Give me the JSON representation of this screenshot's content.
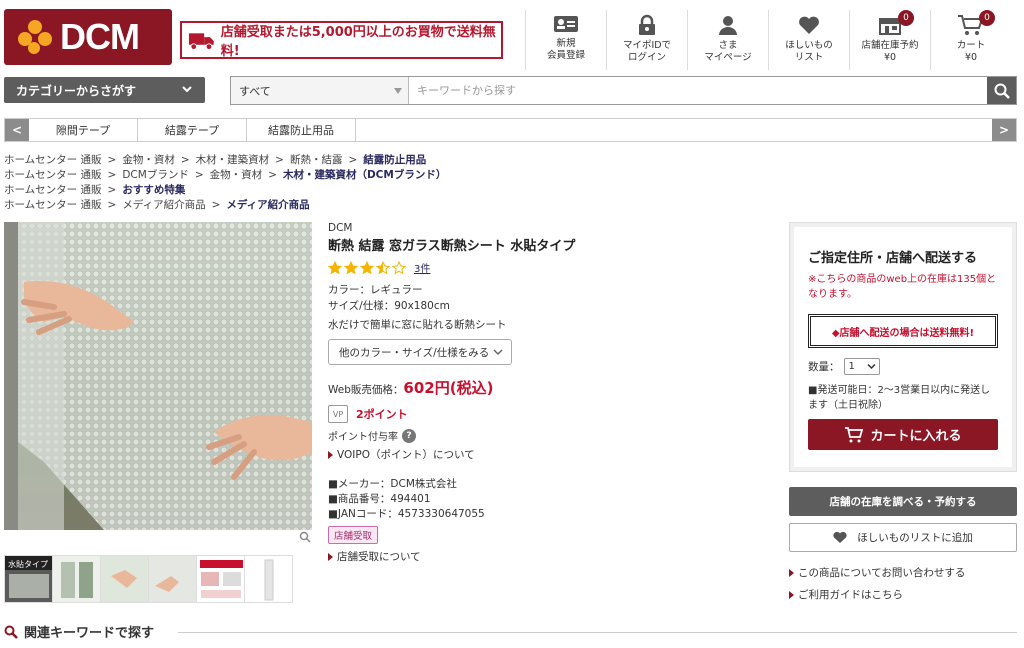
{
  "header": {
    "logo_text": "DCM",
    "promo_text": "店舗受取または5,000円以上のお買物で送料無料!",
    "nav": [
      {
        "line1": "新規",
        "line2": "会員登録",
        "icon": "member-card-icon"
      },
      {
        "line1": "マイポIDで",
        "line2": "ログイン",
        "icon": "lock-icon"
      },
      {
        "line1": "さま",
        "line2": "マイページ",
        "icon": "user-icon"
      },
      {
        "line1": "ほしいもの",
        "line2": "リスト",
        "icon": "heart-icon"
      },
      {
        "line1": "店舗在庫予約",
        "line2": "¥0",
        "icon": "store-icon",
        "badge": "0"
      },
      {
        "line1": "カート",
        "line2": "¥0",
        "icon": "cart-icon",
        "badge": "0"
      }
    ]
  },
  "search": {
    "category_button": "カテゴリーからさがす",
    "scope": "すべて",
    "placeholder": "キーワードから探す"
  },
  "tabs": {
    "prev": "<",
    "next": ">",
    "items": [
      "隙間テープ",
      "結露テープ",
      "結露防止用品"
    ]
  },
  "breadcrumbs": [
    [
      "ホームセンター 通販",
      "金物・資材",
      "木材・建築資材",
      "断熱・結露",
      "結露防止用品"
    ],
    [
      "ホームセンター 通販",
      "DCMブランド",
      "金物・資材",
      "木材・建築資材（DCMブランド）"
    ],
    [
      "ホームセンター 通販",
      "おすすめ特集"
    ],
    [
      "ホームセンター 通販",
      "メディア紹介商品",
      "メディア紹介商品"
    ]
  ],
  "product": {
    "brand": "DCM",
    "title": "断熱 結露 窓ガラス断熱シート 水貼タイプ",
    "rating": 3.5,
    "review_count": "3件",
    "color": "カラー：レギュラー",
    "size": "サイズ/仕様：90x180cm",
    "catch": "水だけで簡単に窓に貼れる断熱シート",
    "variant_button": "他のカラー・サイズ/仕様をみる",
    "price_label": "Web販売価格：",
    "price": "602円(税込)",
    "vp_label": "VP",
    "points": "2ポイント",
    "point_rate_label": "ポイント付与率",
    "voipo_link": "VOIPO（ポイント）について",
    "maker": "■メーカー：DCM株式会社",
    "item_no": "■商品番号：494401",
    "jan": "■JANコード：4573330647055",
    "store_badge": "店舗受取",
    "store_link": "店舗受取について",
    "thumb_label": "水貼タイプ"
  },
  "panel": {
    "title": "ご指定住所・店舗へ配送する",
    "stock_note": "※こちらの商品のweb上の在庫は135個となります。",
    "free_shipping": "◆店舗へ配送の場合は送料無料!",
    "qty_label": "数量：",
    "qty_value": "1",
    "ship_note": "■発送可能日：2〜3営業日以内に発送します（土日祝除）",
    "cart_button": "カートに入れる",
    "stock_button": "店舗の在庫を調べる・予約する",
    "wish_button": "ほしいものリストに追加",
    "inquiry_link": "この商品についてお問い合わせする",
    "guide_link": "ご利用ガイドはこちら"
  },
  "related": {
    "title": "関連キーワードで探す"
  },
  "colors": {
    "brand": "#8b1624",
    "accent_red": "#c8102e",
    "logo_dots": "#f5a623",
    "gray_button": "#5d5d5d"
  }
}
